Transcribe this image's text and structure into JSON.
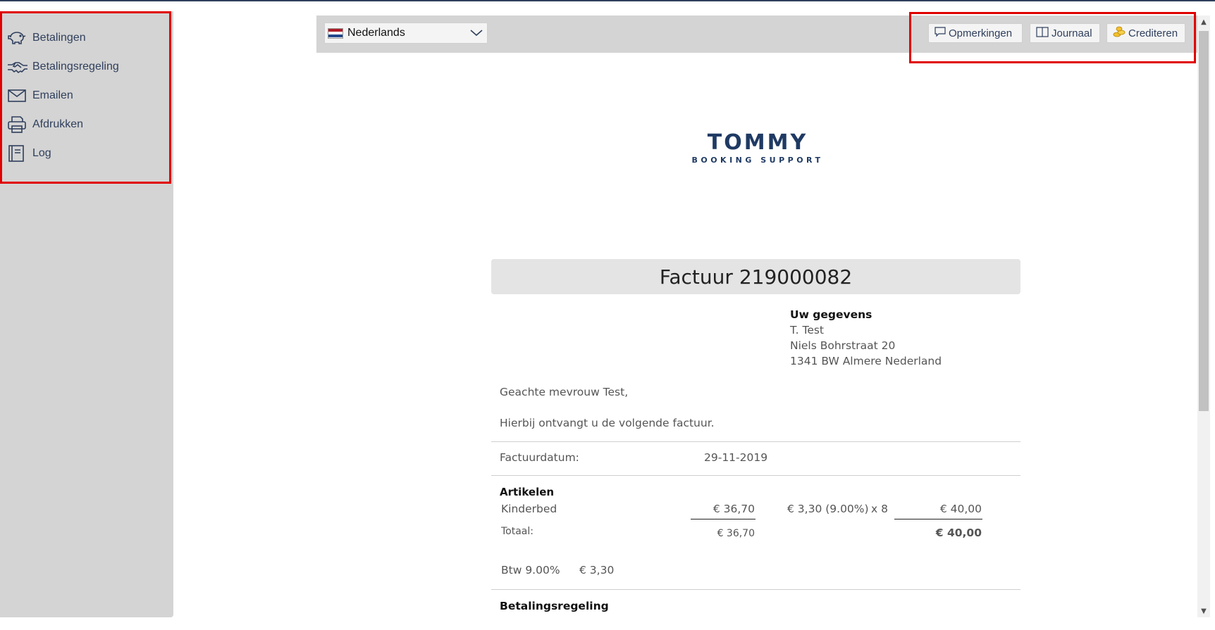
{
  "sidebar": {
    "items": [
      {
        "label": "Betalingen",
        "icon": "piggy-bank-icon"
      },
      {
        "label": "Betalingsregeling",
        "icon": "handshake-icon"
      },
      {
        "label": "Emailen",
        "icon": "envelope-icon"
      },
      {
        "label": "Afdrukken",
        "icon": "printer-icon"
      },
      {
        "label": "Log",
        "icon": "book-icon"
      }
    ]
  },
  "toolbar": {
    "language": "Nederlands",
    "buttons": [
      {
        "label": "Opmerkingen",
        "icon": "comment-icon"
      },
      {
        "label": "Journaal",
        "icon": "journal-icon"
      },
      {
        "label": "Crediteren",
        "icon": "coins-icon"
      }
    ]
  },
  "logo": {
    "main": "TOMMY",
    "sub": "BOOKING SUPPORT"
  },
  "invoice": {
    "title": "Factuur 219000082",
    "customer": {
      "heading": "Uw gegevens",
      "name": "T. Test",
      "street": "Niels Bohrstraat 20",
      "city": "1341 BW Almere Nederland"
    },
    "greeting": "Geachte mevrouw Test,",
    "intro": "Hierbij ontvangt u de volgende factuur.",
    "date_label": "Factuurdatum:",
    "date_value": "29-11-2019",
    "articles_heading": "Artikelen",
    "article": {
      "name": "Kinderbed",
      "price": "€ 36,70",
      "vat": "€ 3,30 (9.00%)",
      "qty": "x 8",
      "total": "€ 40,00"
    },
    "total_label": "Totaal:",
    "total_net": "€ 36,70",
    "total_gross": "€ 40,00",
    "vat_label": "Btw 9.00%",
    "vat_amount": "€ 3,30",
    "payment_heading": "Betalingsregeling"
  },
  "colors": {
    "sidebar_bg": "#d4d4d4",
    "accent": "#2f3f5c",
    "highlight": "#e00000"
  }
}
